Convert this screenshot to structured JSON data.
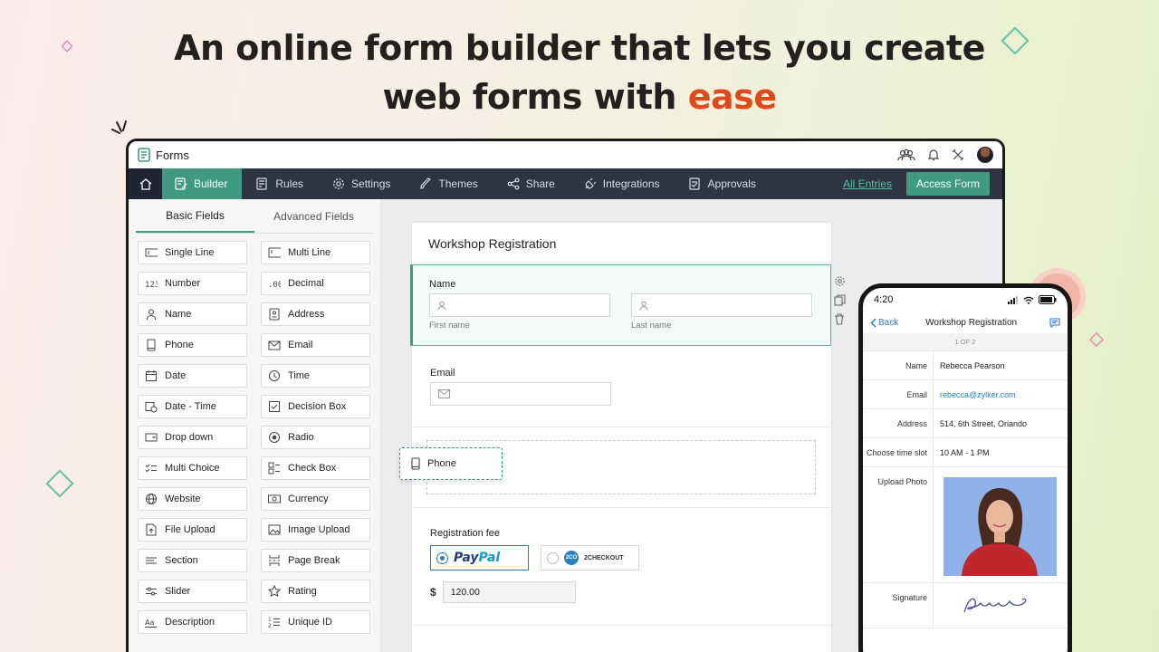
{
  "headline": {
    "line1": "An online form builder that lets you create",
    "line2": "web forms with ",
    "accent": "ease"
  },
  "app": {
    "brand": "Forms",
    "nav": {
      "items": [
        "Builder",
        "Rules",
        "Settings",
        "Themes",
        "Share",
        "Integrations",
        "Approvals"
      ],
      "active": "Builder",
      "all_entries": "All Entries",
      "access_form": "Access Form"
    },
    "left_panel": {
      "tabs": [
        "Basic Fields",
        "Advanced Fields"
      ],
      "fields": [
        {
          "label": "Single Line",
          "icon": "single-line-icon"
        },
        {
          "label": "Multi Line",
          "icon": "multi-line-icon"
        },
        {
          "label": "Number",
          "icon": "number-icon"
        },
        {
          "label": "Decimal",
          "icon": "decimal-icon"
        },
        {
          "label": "Name",
          "icon": "person-icon"
        },
        {
          "label": "Address",
          "icon": "address-icon"
        },
        {
          "label": "Phone",
          "icon": "phone-icon"
        },
        {
          "label": "Email",
          "icon": "envelope-icon"
        },
        {
          "label": "Date",
          "icon": "calendar-icon"
        },
        {
          "label": "Time",
          "icon": "clock-icon"
        },
        {
          "label": "Date - Time",
          "icon": "date-time-icon"
        },
        {
          "label": "Decision Box",
          "icon": "checkbox-icon"
        },
        {
          "label": "Drop down",
          "icon": "dropdown-icon"
        },
        {
          "label": "Radio",
          "icon": "radio-icon"
        },
        {
          "label": "Multi Choice",
          "icon": "multi-choice-icon"
        },
        {
          "label": "Check Box",
          "icon": "check-box-icon"
        },
        {
          "label": "Website",
          "icon": "globe-icon"
        },
        {
          "label": "Currency",
          "icon": "currency-icon"
        },
        {
          "label": "File Upload",
          "icon": "file-upload-icon"
        },
        {
          "label": "Image Upload",
          "icon": "image-upload-icon"
        },
        {
          "label": "Section",
          "icon": "section-icon"
        },
        {
          "label": "Page Break",
          "icon": "page-break-icon"
        },
        {
          "label": "Slider",
          "icon": "slider-icon"
        },
        {
          "label": "Rating",
          "icon": "star-icon"
        },
        {
          "label": "Description",
          "icon": "description-icon"
        },
        {
          "label": "Unique ID",
          "icon": "unique-id-icon"
        }
      ]
    },
    "form": {
      "title": "Workshop Registration",
      "name_label": "Name",
      "first_name": "First name",
      "last_name": "Last name",
      "email_label": "Email",
      "drag_label": "Phone",
      "fee_label": "Registration fee",
      "paypal_1": "Pay",
      "paypal_2": "Pal",
      "checkout_badge": "2CO",
      "checkout": "2CHECKOUT",
      "currency_symbol": "$",
      "amount": "120.00"
    }
  },
  "phone": {
    "time": "4:20",
    "back": "Back",
    "title": "Workshop Registration",
    "page": "1 OF 2",
    "rows": [
      {
        "key": "Name",
        "value": "Rebecca Pearson"
      },
      {
        "key": "Email",
        "value": "rebecca@zylker.com"
      },
      {
        "key": "Address",
        "value": "514, 6th Street, Oriando"
      },
      {
        "key": "Choose time slot",
        "value": "10 AM - 1 PM"
      }
    ],
    "upload_label": "Upload Photo",
    "signature_label": "Signature",
    "signature": "Rebeca"
  }
}
